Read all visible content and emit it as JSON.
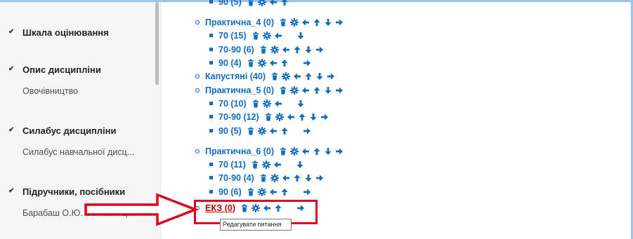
{
  "sidebar": {
    "sections": [
      {
        "title": "Шкала оцінювання",
        "item": ""
      },
      {
        "title": "Опис дисципліни",
        "item": "Овочівництво"
      },
      {
        "title": "Силабус дисципліни",
        "item": "Силабус навчальної дисц..."
      },
      {
        "title": "Підручники, посібники",
        "item": "Барабаш О.Ю. Овочівниц..."
      }
    ]
  },
  "tree": {
    "top_partial": "90 (5)",
    "items": [
      {
        "label": "Практична_4 (0)",
        "level": 1
      },
      {
        "label": "70 (15)",
        "level": 2
      },
      {
        "label": "70-90 (6)",
        "level": 2
      },
      {
        "label": "90 (4)",
        "level": 2
      },
      {
        "label": "Капустяні (40)",
        "level": 1
      },
      {
        "label": "Практична_5 (0)",
        "level": 1
      },
      {
        "label": "70 (10)",
        "level": 2
      },
      {
        "label": "70-90 (12)",
        "level": 2
      },
      {
        "label": "90 (5)",
        "level": 2
      },
      {
        "label": "Практична_6 (0)",
        "level": 1
      },
      {
        "label": "70 (11)",
        "level": 2
      },
      {
        "label": "70-90 (4)",
        "level": 2
      },
      {
        "label": "90 (6)",
        "level": 2
      },
      {
        "label": "ЕКЗ (0)",
        "level": 1
      }
    ]
  },
  "tooltip": {
    "text": "Редагувати питання"
  },
  "colors": {
    "link": "#0f6cbf",
    "annotation": "#e0001b",
    "sidebar_bg": "#f5f5f5"
  }
}
